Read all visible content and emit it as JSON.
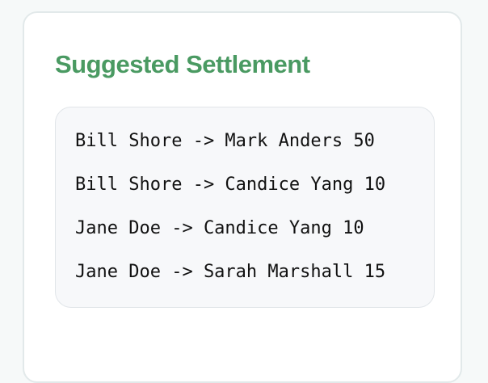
{
  "title": "Suggested Settlement",
  "settlements": [
    "Bill Shore -> Mark Anders 50",
    "Bill Shore -> Candice Yang 10",
    "Jane Doe -> Candice Yang 10",
    "Jane Doe -> Sarah Marshall 15"
  ],
  "colors": {
    "title": "#4a9a62",
    "box_background": "#f7f8fa",
    "card_border": "#e2e9ea"
  }
}
